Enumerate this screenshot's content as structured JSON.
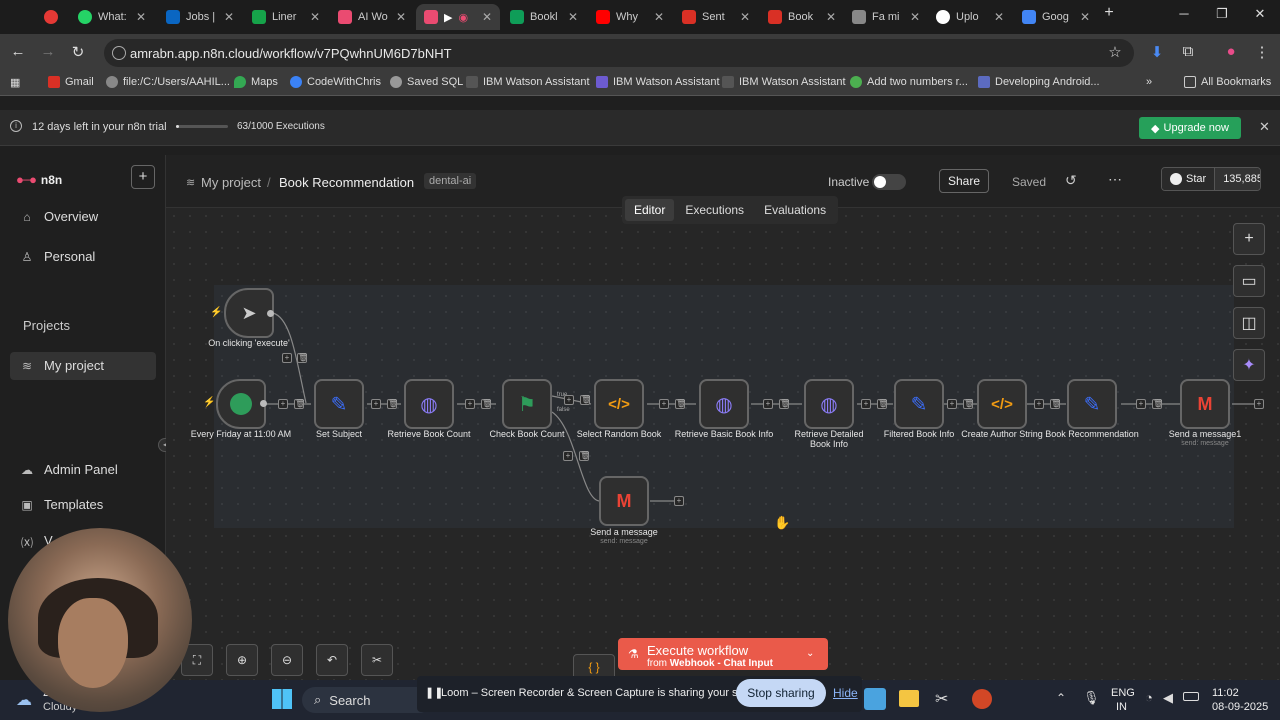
{
  "browser": {
    "tabs": [
      {
        "label": "",
        "color": "#e53935"
      },
      {
        "label": "What:",
        "color": "#25d366"
      },
      {
        "label": "Jobs |",
        "color": "#0a66c2"
      },
      {
        "label": "Liner",
        "color": "#16a34a"
      },
      {
        "label": "AI Wo",
        "color": "#ea4b71"
      },
      {
        "label": "",
        "color": "#ea4b71"
      },
      {
        "label": "Bookl",
        "color": "#0f9d58"
      },
      {
        "label": "Why",
        "color": "#ff0000"
      },
      {
        "label": "Sent",
        "color": "#d93025"
      },
      {
        "label": "Book",
        "color": "#d93025"
      },
      {
        "label": "Fa mi",
        "color": "#888888"
      },
      {
        "label": "Uplo",
        "color": "#ffffff"
      },
      {
        "label": "Goog",
        "color": "#4285f4"
      }
    ],
    "url": "amrabn.app.n8n.cloud/workflow/v7PQwhnUM6D7bNHT",
    "bookmarks": [
      "Gmail",
      "file:/C:/Users/AAHIL...",
      "Maps",
      "CodeWithChris",
      "Saved SQL",
      "IBM Watson Assistant",
      "IBM Watson Assistant",
      "IBM Watson Assistant",
      "Add two numbers r...",
      "Developing Android..."
    ],
    "all_bookmarks": "All Bookmarks"
  },
  "trial": {
    "text": "12 days left in your n8n trial",
    "executions": "63/1000 Executions",
    "executions_used_fraction": 0.063,
    "upgrade": "Upgrade now"
  },
  "sidebar": {
    "logo": "n8n",
    "overview": "Overview",
    "personal": "Personal",
    "projects_heading": "Projects",
    "my_project": "My project",
    "admin": "Admin Panel",
    "templates": "Templates",
    "variables": "V"
  },
  "header": {
    "project": "My project",
    "separator": "/",
    "workflow": "Book Recommendation",
    "tag": "dental-ai",
    "status": "Inactive",
    "share": "Share",
    "saved": "Saved",
    "github_star": "Star",
    "github_count": "135,885"
  },
  "view_tabs": [
    "Editor",
    "Executions",
    "Evaluations"
  ],
  "nodes": [
    {
      "label": "On clicking 'execute'",
      "sub": ""
    },
    {
      "label": "Every Friday at 11:00 AM",
      "sub": ""
    },
    {
      "label": "Set Subject",
      "sub": ""
    },
    {
      "label": "Retrieve Book Count",
      "sub": ""
    },
    {
      "label": "Check Book Count",
      "sub": ""
    },
    {
      "label": "Select Random Book",
      "sub": ""
    },
    {
      "label": "Retrieve Basic Book Info",
      "sub": ""
    },
    {
      "label": "Retrieve Detailed Book Info",
      "sub": ""
    },
    {
      "label": "Filtered Book Info",
      "sub": ""
    },
    {
      "label": "Create Author String",
      "sub": ""
    },
    {
      "label": "Book Recommendation",
      "sub": ""
    },
    {
      "label": "Send a message1",
      "sub": "send: message"
    },
    {
      "label": "Send a message",
      "sub": "send: message"
    }
  ],
  "branch_labels": {
    "true": "true",
    "false": "false"
  },
  "execute": {
    "title": "Execute workflow",
    "from": "from",
    "trigger": "Webhook - Chat Input"
  },
  "loom": {
    "text": "Loom – Screen Recorder & Screen Capture is sharing your screen.",
    "stop": "Stop sharing",
    "hide": "Hide"
  },
  "taskbar": {
    "weather_temp": "21°C",
    "weather_desc": "Cloudy",
    "search": "Search",
    "lang1": "ENG",
    "lang2": "IN",
    "time": "11:02",
    "date": "08-09-2025"
  }
}
